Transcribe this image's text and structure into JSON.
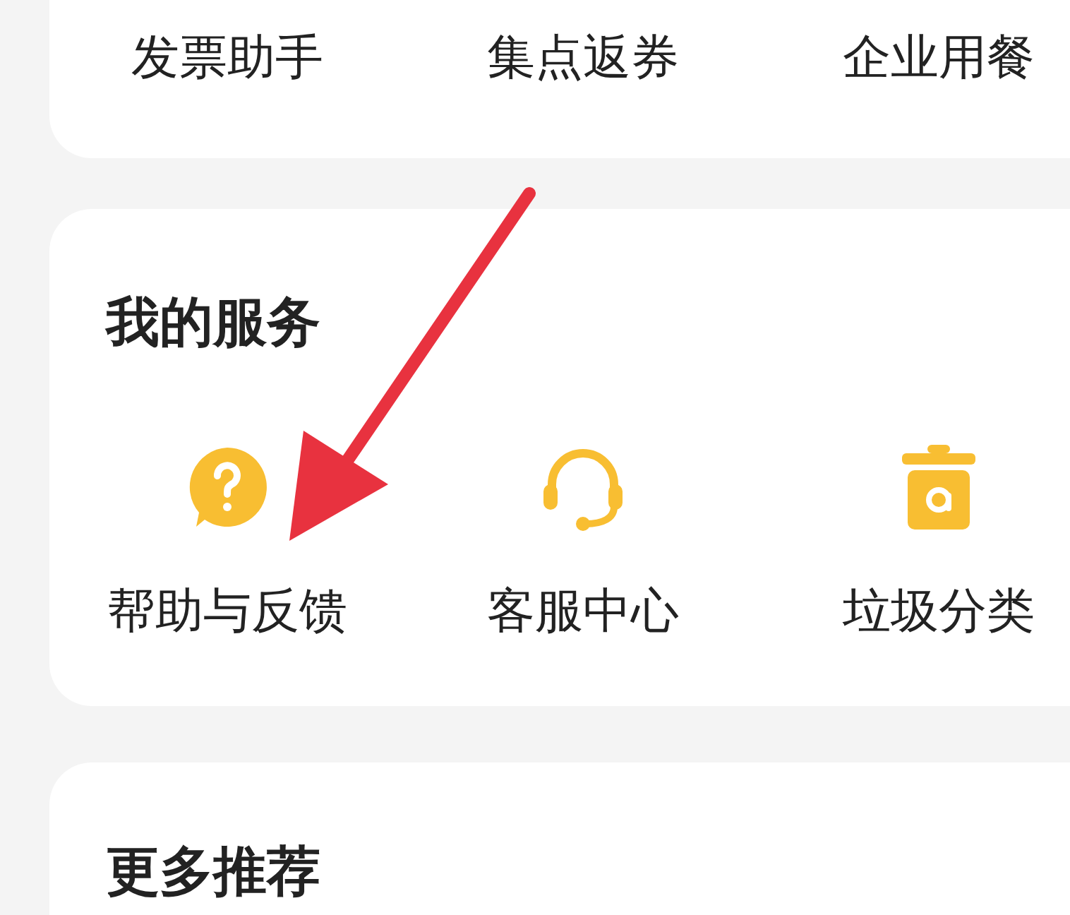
{
  "top_tools": [
    {
      "label": "发票助手"
    },
    {
      "label": "集点返券"
    },
    {
      "label": "企业用餐"
    }
  ],
  "my_services": {
    "title": "我的服务",
    "items": [
      {
        "label": "帮助与反馈",
        "kind": "help"
      },
      {
        "label": "客服中心",
        "kind": "headset"
      },
      {
        "label": "垃圾分类",
        "kind": "trash"
      }
    ]
  },
  "more": {
    "title": "更多推荐"
  }
}
